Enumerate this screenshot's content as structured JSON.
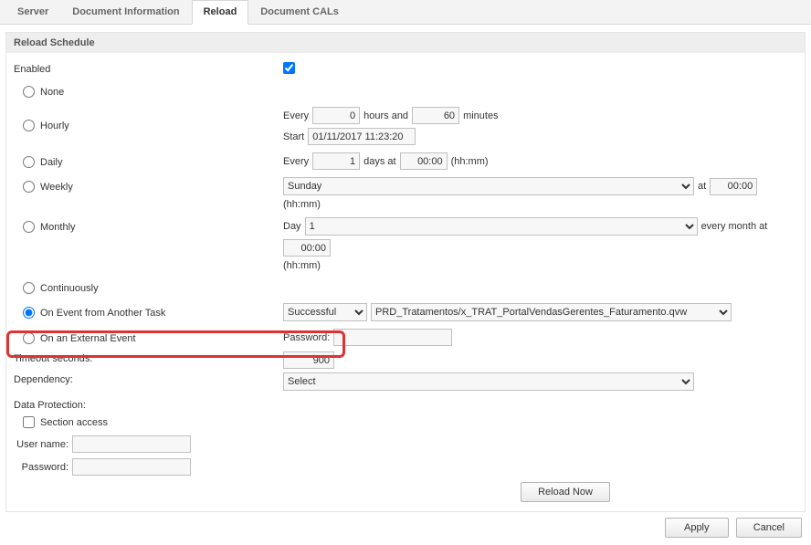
{
  "tabs": {
    "server": "Server",
    "docinfo": "Document Information",
    "reload": "Reload",
    "doccals": "Document CALs"
  },
  "panel": {
    "title": "Reload Schedule"
  },
  "labels": {
    "enabled": "Enabled",
    "none": "None",
    "hourly": "Hourly",
    "daily": "Daily",
    "weekly": "Weekly",
    "monthly": "Monthly",
    "continuously": "Continuously",
    "on_event_task": "On Event from Another Task",
    "on_external_event": "On an External Event",
    "timeout_seconds": "Timeout seconds:",
    "dependency": "Dependency:",
    "data_protection": "Data Protection:",
    "section_access": "Section access",
    "user_name": "User name:",
    "password": "Password:",
    "every": "Every",
    "hours_and": "hours and",
    "minutes": "minutes",
    "start": "Start",
    "days_at": "days at",
    "hhmm": "(hh:mm)",
    "at": "at",
    "day": "Day",
    "every_month_at": "every month at",
    "pwd_label": "Password:"
  },
  "values": {
    "enabled_checked": true,
    "hourly_every": "0",
    "hourly_minutes": "60",
    "hourly_start": "01/11/2017 11:23:20",
    "daily_every": "1",
    "daily_at": "00:00",
    "weekly_day": "Sunday",
    "weekly_at": "00:00",
    "monthly_day": "1",
    "monthly_at": "00:00",
    "event_status": "Successful",
    "event_task": "PRD_Tratamentos/x_TRAT_PortalVendasGerentes_Faturamento.qvw",
    "event_password": "",
    "timeout_seconds": "900",
    "dependency": "Select",
    "section_access_checked": false,
    "dp_username": "",
    "dp_password": ""
  },
  "buttons": {
    "reload_now": "Reload Now",
    "apply": "Apply",
    "cancel": "Cancel"
  }
}
